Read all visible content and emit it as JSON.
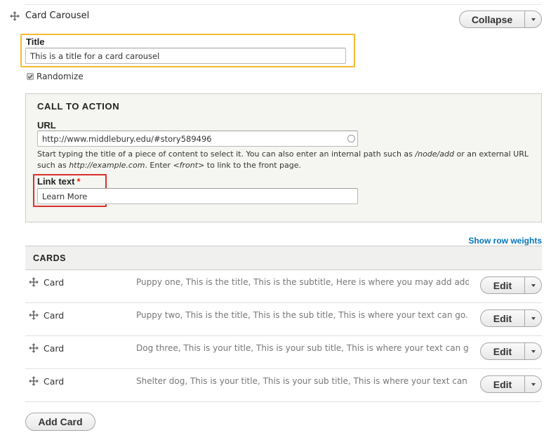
{
  "paragraph": {
    "title": "Card Carousel",
    "collapse_label": "Collapse"
  },
  "title_field": {
    "label": "Title",
    "value": "This is a title for a card carousel"
  },
  "randomize": {
    "label": "Randomize",
    "checked": true
  },
  "cta": {
    "legend": "CALL TO ACTION",
    "url_label": "URL",
    "url_value": "http://www.middlebury.edu/#story589496",
    "help_parts": [
      "Start typing the title of a piece of content to select it. You can also enter an internal path such as ",
      "/node/add",
      " or an external URL such as ",
      "http://example.com",
      ". Enter ",
      "<front>",
      " to link to the front page."
    ],
    "link_text_label": "Link text",
    "required_marker": "*",
    "link_text_value": "Learn More"
  },
  "show_row_weights": "Show row weights",
  "cards": {
    "header": "CARDS",
    "edit_label": "Edit",
    "rows": [
      {
        "label": "Card",
        "summary": "Puppy one, This is the title, This is the subtitle, Here is where you may add additional text"
      },
      {
        "label": "Card",
        "summary": "Puppy two, This is the title, This is the sub title, This is where your text can go., Link"
      },
      {
        "label": "Card",
        "summary": "Dog three, This is your title, This is your sub title, This is where your text can go., Link"
      },
      {
        "label": "Card",
        "summary": "Shelter dog, This is your title, This is your sub title, This is where your text can go., Link"
      }
    ]
  },
  "add_card_label": "Add Card",
  "colors": {
    "title_highlight": "#f5b82e",
    "link_text_highlight": "#d9302c",
    "link": "#0074bd",
    "required": "#e62600"
  }
}
